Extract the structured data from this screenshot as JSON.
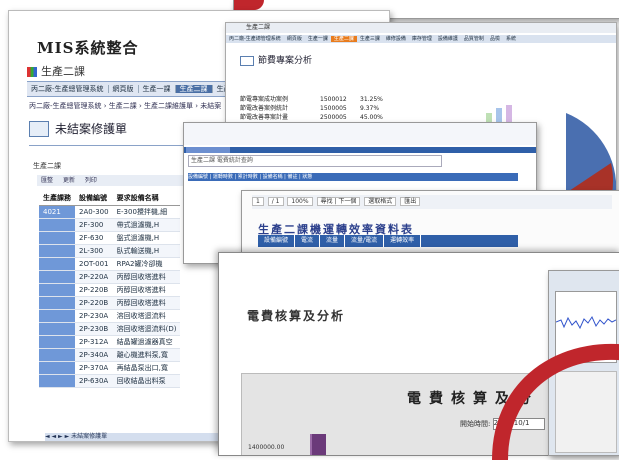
{
  "w1": {
    "title": "MIS系統整合",
    "logo_text": "生產二課",
    "menu": [
      "丙二廠-生產總管理系統",
      "網頁版",
      "生產一課",
      "生產二課",
      "生產三課"
    ],
    "menu_active_index": 3,
    "breadcrumb": "丙二廠-生產總管理系統 › 生產二課 › 生產二課維護單 › 未結案",
    "page_title": "未結案修護單",
    "dept": "生產二課",
    "toolbar": [
      "匯整",
      "更新",
      "列印"
    ],
    "table": {
      "headers": [
        "生產課務",
        "設備編號",
        "要求設備名稱"
      ],
      "dept_cell": "4021",
      "rows": [
        [
          "2A0-300",
          "E-300攪拌機,細"
        ],
        [
          "2F-300",
          "帶式過濾機,H"
        ],
        [
          "2F-630",
          "盤式過濾機,H"
        ],
        [
          "2L-300",
          "臥式輸送機,H"
        ],
        [
          "2OT-001",
          "RPA2罐冷卻機"
        ],
        [
          "2P-220A",
          "丙醇回收塔進料"
        ],
        [
          "2P-220B",
          "丙醇回收塔進料"
        ],
        [
          "2P-220B",
          "丙醇回收塔進料"
        ],
        [
          "2P-230A",
          "溶回收塔迴流料"
        ],
        [
          "2P-230B",
          "溶回收塔迴流料(D)"
        ],
        [
          "2P-312A",
          "結晶罐過濾器真空"
        ],
        [
          "2P-340A",
          "離心機進料泵,寬"
        ],
        [
          "2P-370A",
          "再結晶泵出口,寬"
        ],
        [
          "2P-630A",
          "回收結晶出料泵"
        ]
      ]
    },
    "pager": "未結案修護單"
  },
  "w2": {
    "title_bar": "生產二課",
    "menu": [
      "丙二廠-生產總管理系統",
      "網頁版",
      "生產一課",
      "生產二課",
      "生產三課",
      "維修設備",
      "庫存管理",
      "設備維護",
      "品質管制",
      "品檢",
      "系統"
    ],
    "menu_active_index": 3,
    "page_title": "節費專案分析",
    "rows": [
      [
        "節電專案成功案例",
        "1500012",
        "31.25%"
      ],
      [
        "節電改善案例統計",
        "1500005",
        "9.37%"
      ],
      [
        "節電改善專案計畫",
        "2500005",
        "45.00%"
      ]
    ]
  },
  "w3": {
    "search_placeholder": "生產二課 電費統計查詢",
    "tabs": "設備編號 | 運轉時數 | 累計時數 | 設備名稱 | 備註 | 狀態"
  },
  "w4": {
    "tool": [
      "1",
      "/ 1",
      "100%",
      "尋找 | 下一個",
      "選取格式",
      "匯出"
    ],
    "report_title": "生產二課機運轉效率資料表",
    "table_headers": [
      "設備編號",
      "電流",
      "流量",
      "流量/電流",
      "運轉效率"
    ]
  },
  "w5": {
    "heading": "電費核算及分析",
    "sheet_title": "電費核算及分",
    "date_label": "開始時間:",
    "date_value": "2005/10/1",
    "y_value": "1400000.00"
  },
  "colors": {
    "brand_blue": "#2f5fa8",
    "accent_red": "#c0262c",
    "active_orange": "#e87c1e"
  }
}
